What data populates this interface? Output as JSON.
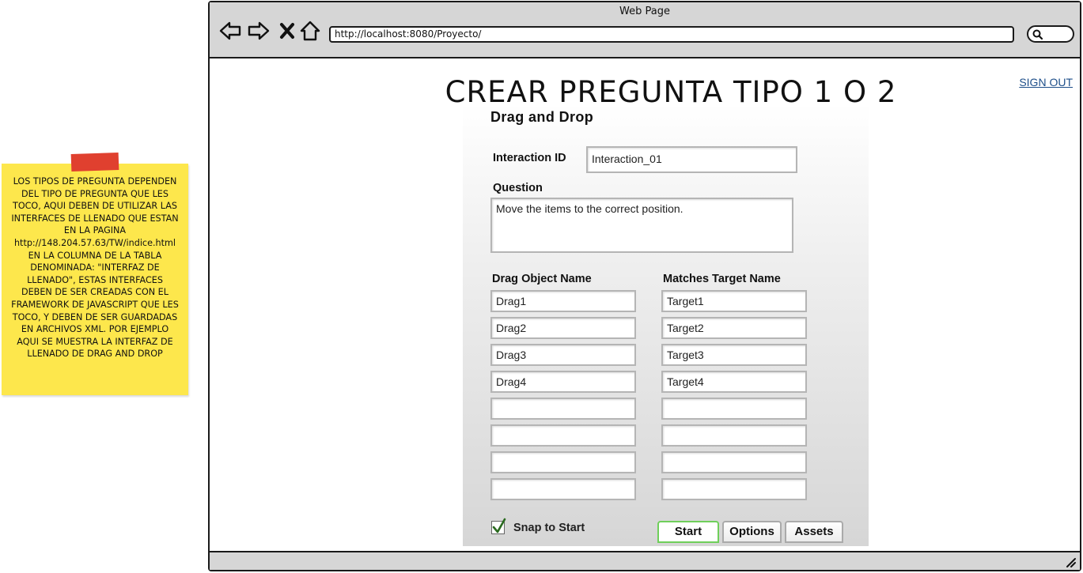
{
  "sticky_note": {
    "text": "LOS TIPOS DE PREGUNTA DEPENDEN DEL TIPO DE PREGUNTA QUE LES TOCO, AQUI DEBEN DE UTILIZAR LAS INTERFACES DE LLENADO QUE ESTAN EN LA PAGINA http://148.204.57.63/TW/indice.html EN LA COLUMNA DE LA TABLA DENOMINADA: \"INTERFAZ DE LLENADO\", ESTAS INTERFACES DEBEN DE SER CREADAS CON EL FRAMEWORK DE JAVASCRIPT QUE LES TOCO, Y DEBEN DE SER GUARDADAS EN ARCHIVOS XML. POR EJEMPLO AQUI SE MUESTRA LA INTERFAZ DE LLENADO DE DRAG AND DROP",
    "color": "#fde74c",
    "tape_color": "#e0402f"
  },
  "browser": {
    "title": "Web Page",
    "url": "http://localhost:8080/Proyecto/",
    "nav_icons": [
      "back-arrow-icon",
      "forward-arrow-icon",
      "close-x-icon",
      "home-icon"
    ]
  },
  "page": {
    "heading": "CREAR PREGUNTA TIPO 1 O 2",
    "sign_out": "SIGN OUT"
  },
  "form": {
    "title": "Drag and Drop",
    "interaction_id_label": "Interaction ID",
    "interaction_id_value": "Interaction_01",
    "question_label": "Question",
    "question_value": "Move the items to the correct position.",
    "drag_header": "Drag Object Name",
    "target_header": "Matches Target Name",
    "rows": [
      {
        "drag": "Drag1",
        "target": "Target1"
      },
      {
        "drag": "Drag2",
        "target": "Target2"
      },
      {
        "drag": "Drag3",
        "target": "Target3"
      },
      {
        "drag": "Drag4",
        "target": "Target4"
      },
      {
        "drag": "",
        "target": ""
      },
      {
        "drag": "",
        "target": ""
      },
      {
        "drag": "",
        "target": ""
      },
      {
        "drag": "",
        "target": ""
      }
    ],
    "snap_label": "Snap to Start",
    "snap_checked": true,
    "tabs": [
      {
        "label": "Start",
        "active": true
      },
      {
        "label": "Options",
        "active": false
      },
      {
        "label": "Assets",
        "active": false
      }
    ],
    "active_tab_color": "#6fcf5a"
  }
}
